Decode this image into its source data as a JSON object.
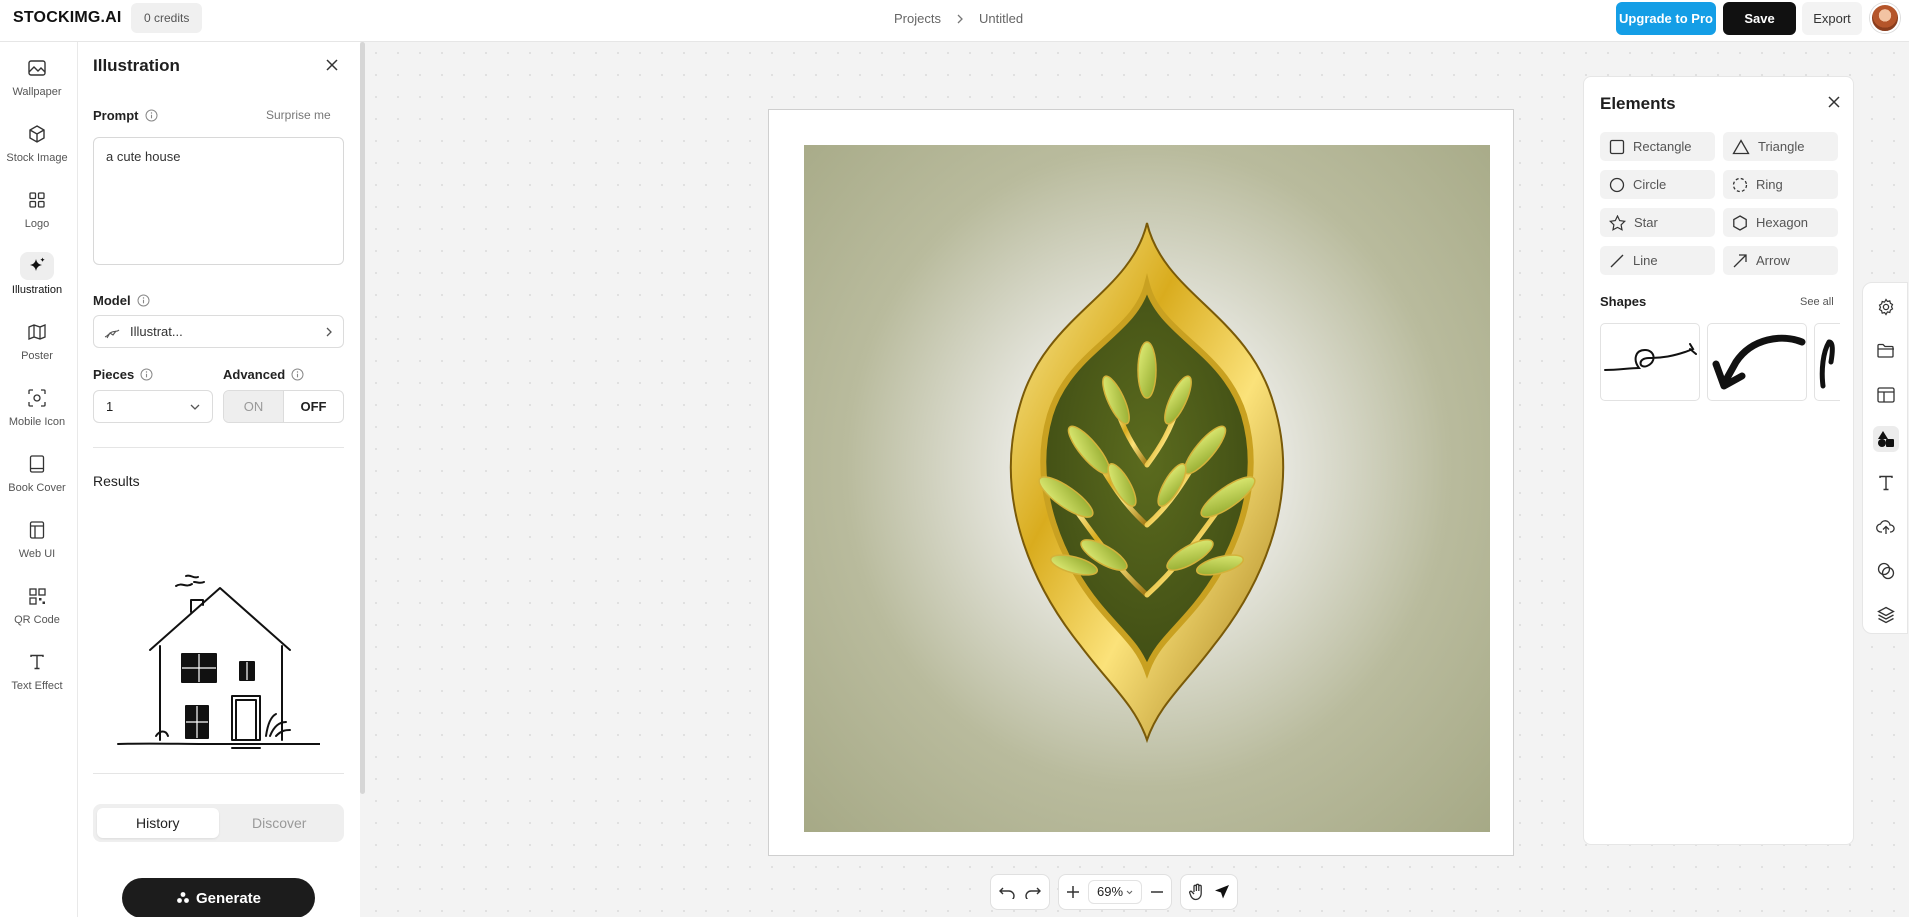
{
  "app": {
    "brand": "STOCKIMG.AI",
    "credits": "0 credits"
  },
  "breadcrumb": {
    "projects": "Projects",
    "current": "Untitled"
  },
  "header_actions": {
    "upgrade": "Upgrade to Pro",
    "save": "Save",
    "export": "Export"
  },
  "rail": {
    "items": [
      {
        "label": "Wallpaper",
        "icon": "image-icon"
      },
      {
        "label": "Stock Image",
        "icon": "cube-icon"
      },
      {
        "label": "Logo",
        "icon": "grid-icon"
      },
      {
        "label": "Illustration",
        "icon": "sparkle-icon",
        "active": true
      },
      {
        "label": "Poster",
        "icon": "map-icon"
      },
      {
        "label": "Mobile Icon",
        "icon": "app-icon"
      },
      {
        "label": "Book Cover",
        "icon": "book-icon"
      },
      {
        "label": "Web UI",
        "icon": "layout-icon"
      },
      {
        "label": "QR Code",
        "icon": "qr-icon"
      },
      {
        "label": "Text Effect",
        "icon": "text-icon"
      }
    ]
  },
  "panel": {
    "title": "Illustration",
    "prompt_label": "Prompt",
    "surprise": "Surprise me",
    "prompt_value": "a cute house",
    "model_label": "Model",
    "model_value": "Illustrat...",
    "pieces_label": "Pieces",
    "pieces_value": "1",
    "advanced_label": "Advanced",
    "advanced_on": "ON",
    "advanced_off": "OFF",
    "results_title": "Results",
    "tab_history": "History",
    "tab_discover": "Discover",
    "generate": "Generate"
  },
  "zoom": {
    "value": "69%"
  },
  "elements": {
    "title": "Elements",
    "shapes": [
      {
        "label": "Rectangle",
        "icon": "rectangle-icon"
      },
      {
        "label": "Triangle",
        "icon": "triangle-icon"
      },
      {
        "label": "Circle",
        "icon": "circle-icon"
      },
      {
        "label": "Ring",
        "icon": "ring-icon"
      },
      {
        "label": "Star",
        "icon": "star-icon"
      },
      {
        "label": "Hexagon",
        "icon": "hexagon-icon"
      },
      {
        "label": "Line",
        "icon": "line-icon"
      },
      {
        "label": "Arrow",
        "icon": "arrow-icon"
      }
    ],
    "shapes_title": "Shapes",
    "see_all": "See all"
  },
  "tools": [
    "settings-icon",
    "folder-icon",
    "template-icon",
    "elements-icon",
    "text-tool-icon",
    "upload-icon",
    "sticker-icon",
    "layers-icon"
  ],
  "colors": {
    "accent": "#149ee6",
    "dark": "#111111",
    "canvas_bg": "#f3f3f3"
  }
}
